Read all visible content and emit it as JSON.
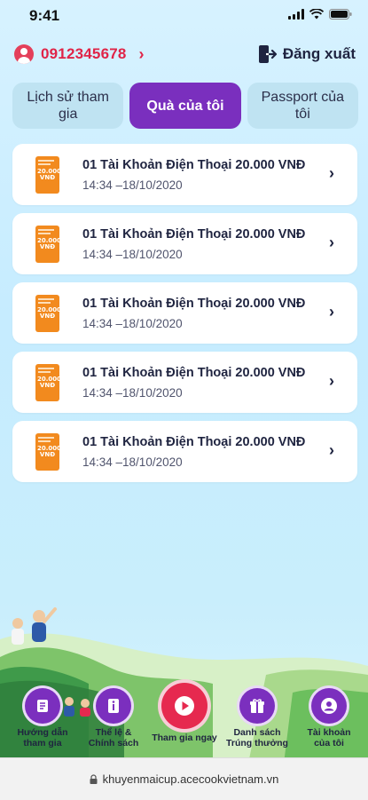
{
  "status_bar": {
    "time": "9:41"
  },
  "header": {
    "phone": "0912345678",
    "logout_label": "Đăng xuất"
  },
  "tabs": [
    {
      "label": "Lịch sử tham gia",
      "active": false
    },
    {
      "label": "Quà của tôi",
      "active": true
    },
    {
      "label": "Passport của tôi",
      "active": false
    }
  ],
  "gifts": [
    {
      "voucher_amount": "20.000 VNĐ",
      "title": "01 Tài Khoản Điện Thoại 20.000 VNĐ",
      "time": "14:34 –18/10/2020"
    },
    {
      "voucher_amount": "20.000 VNĐ",
      "title": "01 Tài Khoản Điện Thoại 20.000 VNĐ",
      "time": "14:34 –18/10/2020"
    },
    {
      "voucher_amount": "20.000 VNĐ",
      "title": "01 Tài Khoản Điện Thoại 20.000 VNĐ",
      "time": "14:34 –18/10/2020"
    },
    {
      "voucher_amount": "20.000 VNĐ",
      "title": "01 Tài Khoản Điện Thoại 20.000 VNĐ",
      "time": "14:34 –18/10/2020"
    },
    {
      "voucher_amount": "20.000 VNĐ",
      "title": "01 Tài Khoản Điện Thoại 20.000 VNĐ",
      "time": "14:34 –18/10/2020"
    }
  ],
  "bottom_nav": [
    {
      "label_line1": "Hướng dẫn",
      "label_line2": "tham gia",
      "icon": "scroll-icon"
    },
    {
      "label_line1": "Thể lệ &",
      "label_line2": "Chính sách",
      "icon": "info-book-icon"
    },
    {
      "label_line1": "Tham gia ngay",
      "label_line2": "",
      "icon": "play-icon"
    },
    {
      "label_line1": "Danh sách",
      "label_line2": "Trúng thưởng",
      "icon": "gift-icon"
    },
    {
      "label_line1": "Tài khoản",
      "label_line2": "của tôi",
      "icon": "user-icon"
    }
  ],
  "url_bar": {
    "url": "khuyenmaicup.acecookvietnam.vn"
  },
  "colors": {
    "accent_purple": "#7a2fbe",
    "accent_red": "#e02447",
    "voucher_orange": "#f28a1e"
  }
}
